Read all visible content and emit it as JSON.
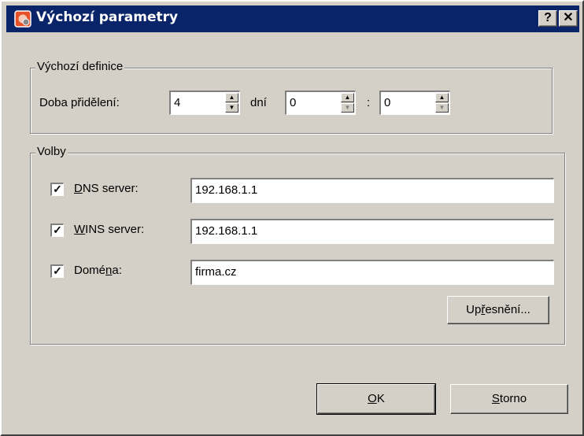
{
  "window": {
    "title": "Výchozí parametry",
    "help_label": "?",
    "close_label": "✕"
  },
  "default_group": {
    "legend": "Výchozí definice",
    "lease_label": "Doba přidělení:",
    "days_value": "4",
    "days_label": "dní",
    "hours_value": "0",
    "separator": ":",
    "minutes_value": "0"
  },
  "options_group": {
    "legend": "Volby",
    "dns": {
      "checked": true,
      "label_ul": "D",
      "label_rest": "NS server:",
      "value": "192.168.1.1"
    },
    "wins": {
      "checked": true,
      "label_ul": "W",
      "label_rest": "INS server:",
      "value": "192.168.1.1"
    },
    "domain": {
      "checked": true,
      "label_pre": "Domé",
      "label_ul": "n",
      "label_rest": "a:",
      "value": "firma.cz"
    },
    "advanced": {
      "pre": "Up",
      "ul": "ř",
      "rest": "esnění..."
    }
  },
  "buttons": {
    "ok": {
      "ul": "O",
      "rest": "K"
    },
    "cancel": {
      "ul": "S",
      "rest": "torno"
    }
  },
  "colors": {
    "titlebar": "#0a246a",
    "face": "#d4d0c8"
  }
}
